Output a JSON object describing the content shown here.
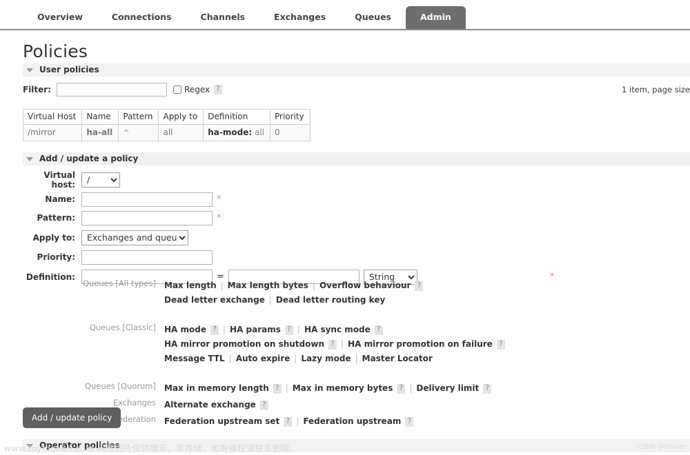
{
  "tabs": [
    {
      "label": "Overview",
      "active": false
    },
    {
      "label": "Connections",
      "active": false
    },
    {
      "label": "Channels",
      "active": false
    },
    {
      "label": "Exchanges",
      "active": false
    },
    {
      "label": "Queues",
      "active": false
    },
    {
      "label": "Admin",
      "active": true
    }
  ],
  "page": {
    "title": "Policies"
  },
  "user_policies": {
    "section_label": "User policies",
    "filter": {
      "label": "Filter:",
      "value": "",
      "placeholder": "",
      "regex_label": "Regex",
      "regex_checked": false,
      "help": "?"
    },
    "pagesize_text": "1 item, page size",
    "columns": [
      "Virtual Host",
      "Name",
      "Pattern",
      "Apply to",
      "Definition",
      "Priority"
    ],
    "rows": [
      {
        "virtual_host": "/mirror",
        "name": "ha-all",
        "pattern": "^",
        "apply_to": "all",
        "definition_key": "ha-mode:",
        "definition_value": "all",
        "priority": "0"
      }
    ]
  },
  "add_policy": {
    "section_label": "Add / update a policy",
    "fields": {
      "virtual_host_label": "Virtual host:",
      "virtual_host_value": "/",
      "name_label": "Name:",
      "name_value": "",
      "pattern_label": "Pattern:",
      "pattern_value": "",
      "apply_to_label": "Apply to:",
      "apply_to_value": "Exchanges and queues",
      "priority_label": "Priority:",
      "priority_value": "",
      "definition_label": "Definition:",
      "definition_key_value": "",
      "definition_val_value": "",
      "definition_type_value": "String",
      "equals": "=",
      "required_marker": "*"
    },
    "groups": [
      {
        "category": "Queues [All types]",
        "lines": [
          [
            {
              "label": "Max length",
              "help": false
            },
            {
              "label": "Max length bytes",
              "help": false
            },
            {
              "label": "Overflow behaviour",
              "help": true
            }
          ],
          [
            {
              "label": "Dead letter exchange",
              "help": false
            },
            {
              "label": "Dead letter routing key",
              "help": false
            }
          ]
        ]
      },
      {
        "category": "Queues [Classic]",
        "lines": [
          [
            {
              "label": "HA mode",
              "help": true
            },
            {
              "label": "HA params",
              "help": true
            },
            {
              "label": "HA sync mode",
              "help": true
            }
          ],
          [
            {
              "label": "HA mirror promotion on shutdown",
              "help": true
            },
            {
              "label": "HA mirror promotion on failure",
              "help": true
            }
          ],
          [
            {
              "label": "Message TTL",
              "help": false
            },
            {
              "label": "Auto expire",
              "help": false
            },
            {
              "label": "Lazy mode",
              "help": false
            },
            {
              "label": "Master Locator",
              "help": false
            }
          ]
        ]
      },
      {
        "category": "Queues [Quorum]",
        "lines": [
          [
            {
              "label": "Max in memory length",
              "help": true
            },
            {
              "label": "Max in memory bytes",
              "help": true
            },
            {
              "label": "Delivery limit",
              "help": true
            }
          ]
        ]
      },
      {
        "category": "Exchanges",
        "lines": [
          [
            {
              "label": "Alternate exchange",
              "help": true
            }
          ]
        ]
      },
      {
        "category": "Federation",
        "lines": [
          [
            {
              "label": "Federation upstream set",
              "help": true
            },
            {
              "label": "Federation upstream",
              "help": true
            }
          ]
        ]
      }
    ],
    "submit_label": "Add / update policy"
  },
  "operator_policies": {
    "section_label": "Operator policies"
  },
  "watermark": {
    "left": "www.toymoban.com 网络图片仅供展示，非存储，如有侵权请联系删除。",
    "right": "CSDN @friover"
  },
  "icons": {
    "collapse": "triangle-down-icon",
    "help": "question-mark-icon"
  },
  "colors": {
    "active_tab_bg": "#6e6e6e",
    "section_bg": "#f2f2f2",
    "required": "#f1807e",
    "button_bg": "#5f5f5f"
  }
}
